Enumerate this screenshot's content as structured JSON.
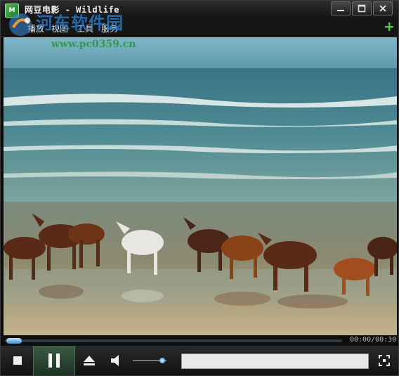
{
  "window": {
    "title": "网豆电影 - Wildlife",
    "app_icon": "app-logo-icon",
    "controls": [
      "minimize-icon",
      "maximize-icon",
      "close-icon"
    ]
  },
  "watermark": {
    "name": "河东软件园",
    "url": "www.pc0359.cn"
  },
  "menu": {
    "items": [
      {
        "label": "播放"
      },
      {
        "label": "视图"
      },
      {
        "label": "工具"
      },
      {
        "label": "服务"
      }
    ],
    "add_icon": "plus-icon"
  },
  "video": {
    "description_icon": "video-frame"
  },
  "playback": {
    "time": "00:00/00:30",
    "progress": 0.0
  },
  "controls": {
    "stop_icon": "stop-icon",
    "pause_icon": "pause-icon",
    "eject_icon": "eject-icon",
    "volume_icon": "speaker-icon",
    "volume_level": 0.8,
    "status_text": "",
    "fullscreen_icon": "fullscreen-icon"
  },
  "colors": {
    "accent_green": "#41d14a",
    "seek_blue": "#6aa9d6",
    "pause_bg": "#2e4a36"
  }
}
